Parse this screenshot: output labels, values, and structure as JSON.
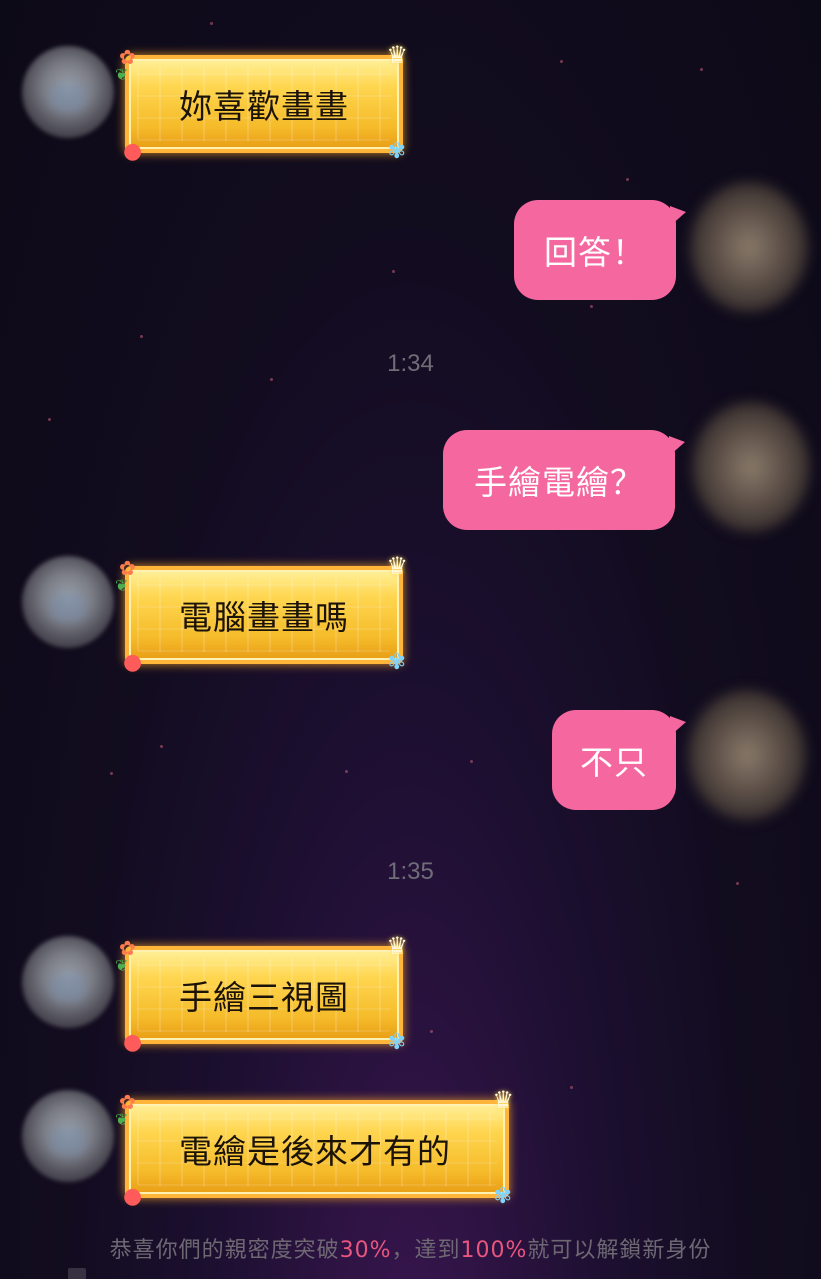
{
  "messages": [
    {
      "side": "left",
      "text": "妳喜歡畫畫"
    },
    {
      "side": "right",
      "text": "回答！"
    },
    {
      "side": "right",
      "text": "手繪電繪？"
    },
    {
      "side": "left",
      "text": "電腦畫畫嗎"
    },
    {
      "side": "right",
      "text": "不只"
    },
    {
      "side": "left",
      "text": "手繪三視圖"
    },
    {
      "side": "left",
      "text": "電繪是後來才有的"
    }
  ],
  "timestamps": [
    "1:34",
    "1:35"
  ],
  "notice": {
    "part1": "恭喜你們的親密度突破",
    "percent1": "30%",
    "part2": "，達到",
    "percent2": "100%",
    "part3": "就可以解鎖新身份"
  },
  "colors": {
    "pink_bubble": "#f5679f",
    "gold_bubble": "#f5bb2a",
    "highlight": "#e8557f",
    "background": "#120c1f"
  },
  "icons": {
    "bubble_decoration": "fruit-flower-crown-frame"
  }
}
